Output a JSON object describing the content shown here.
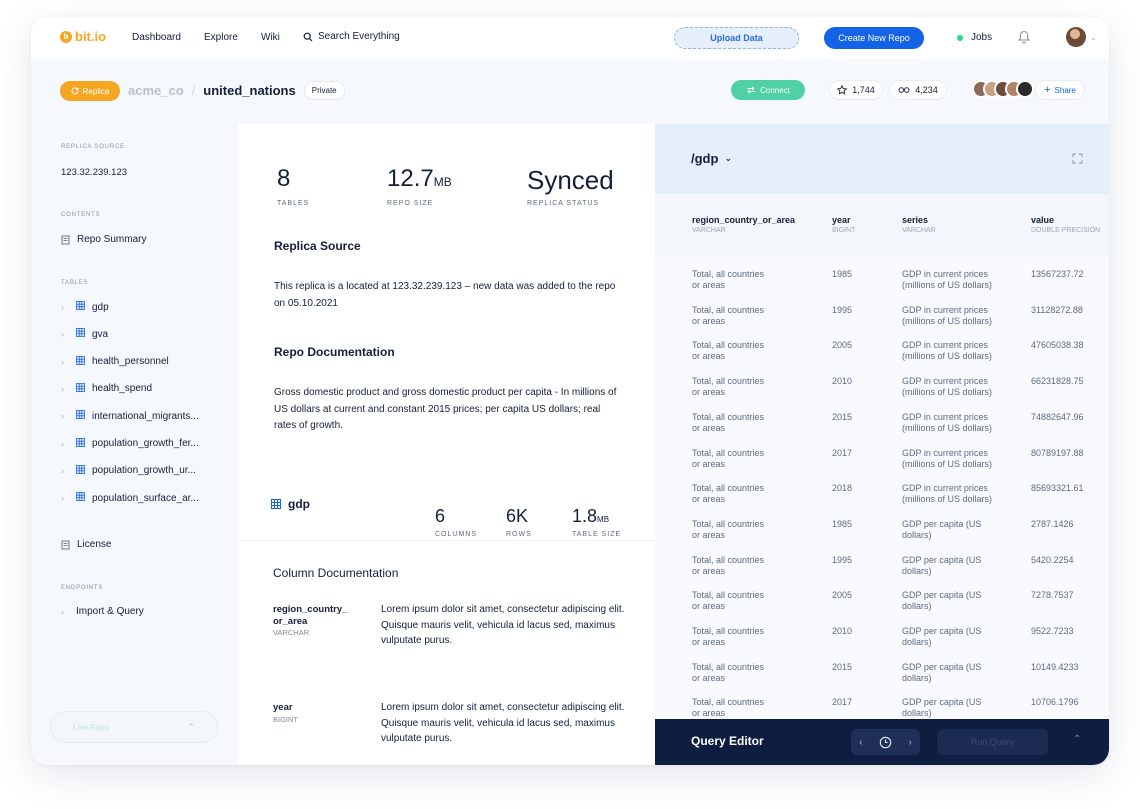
{
  "nav": {
    "logo_mark": "b",
    "logo": "bit.io",
    "links": [
      "Dashboard",
      "Explore",
      "Wiki"
    ],
    "search": "Search Everything",
    "upload": "Upload Data",
    "create": "Create New Repo",
    "jobs": "Jobs"
  },
  "header": {
    "replica": "Replica",
    "org": "acme_co",
    "repo": "united_nations",
    "visibility": "Private",
    "connect": "Connect",
    "stars": "1,744",
    "forks": "4,234",
    "share": "Share"
  },
  "sidebar": {
    "replica_source_label": "REPLICA SOURCE",
    "replica_source": "123.32.239.123",
    "contents_label": "CONTENTS",
    "repo_summary": "Repo Summary",
    "tables_label": "TABLES",
    "tables": [
      "gdp",
      "gva",
      "health_personnel",
      "health_spend",
      "international_migrants...",
      "population_growth_fer...",
      "population_growth_ur...",
      "population_surface_ar..."
    ],
    "license": "License",
    "endpoints_label": "ENDPOINTS",
    "import_query": "Import & Query",
    "live_repo": "Live Repo"
  },
  "summary": {
    "tables_value": "8",
    "tables_label": "TABLES",
    "size_value": "12.7",
    "size_unit": "MB",
    "size_label": "REPO SIZE",
    "status_value": "Synced",
    "status_label": "REPLICA STATUS",
    "replica_title": "Replica Source",
    "replica_text": "This replica is a located at 123.32.239.123 – new data was added to the repo on 05.10.2021",
    "doc_title": "Repo Documentation",
    "doc_text": "Gross domestic product and gross domestic product per capita - In millions of US dollars at current and constant 2015 prices; per capita US dollars; real rates of growth."
  },
  "table_info": {
    "name": "gdp",
    "columns_value": "6",
    "columns_label": "COLUMNS",
    "rows_value": "6K",
    "rows_label": "ROWS",
    "size_value": "1.8",
    "size_unit": "MB",
    "size_label": "TABLE SIZE"
  },
  "column_doc": {
    "title": "Column Documentation",
    "items": [
      {
        "name": "region_country_\nor_area",
        "type": "VARCHAR",
        "desc": "Lorem ipsum dolor sit amet, consectetur adipiscing elit. Quisque mauris velit, vehicula id lacus sed, maximus vulputate purus."
      },
      {
        "name": "year",
        "type": "BIGINT",
        "desc": "Lorem ipsum dolor sit amet, consectetur adipiscing elit. Quisque mauris velit, vehicula id lacus sed, maximus vulputate purus."
      }
    ]
  },
  "data_view": {
    "path": "/gdp",
    "columns": [
      {
        "name": "region_country_or_area",
        "type": "VARCHAR"
      },
      {
        "name": "year",
        "type": "BIGINT"
      },
      {
        "name": "series",
        "type": "VARCHAR"
      },
      {
        "name": "value",
        "type": "DOUBLE PRECISION"
      }
    ],
    "rows": [
      [
        "Total, all countries\nor areas",
        "1985",
        "GDP in current prices\n(millions of US dollars)",
        "13567237.72"
      ],
      [
        "Total, all countries\nor areas",
        "1995",
        "GDP in current prices\n(millions of US dollars)",
        "31128272.88"
      ],
      [
        "Total, all countries\nor areas",
        "2005",
        "GDP in current prices\n(millions of US dollars)",
        "47605038.38"
      ],
      [
        "Total, all countries\nor areas",
        "2010",
        "GDP in current prices\n(millions of US dollars)",
        "66231828.75"
      ],
      [
        "Total, all countries\nor areas",
        "2015",
        "GDP in current prices\n(millions of US dollars)",
        "74882647.96"
      ],
      [
        "Total, all countries\nor areas",
        "2017",
        "GDP in current prices\n(millions of US dollars)",
        "80789197.88"
      ],
      [
        "Total, all countries\nor areas",
        "2018",
        "GDP in current prices\n(millions of US dollars)",
        "85693321.61"
      ],
      [
        "Total, all countries\nor areas",
        "1985",
        "GDP per capita (US\ndollars)",
        "2787.1426"
      ],
      [
        "Total, all countries\nor areas",
        "1995",
        "GDP per capita (US\ndollars)",
        "5420.2254"
      ],
      [
        "Total, all countries\nor areas",
        "2005",
        "GDP per capita (US\ndollars)",
        "7278.7537"
      ],
      [
        "Total, all countries\nor areas",
        "2010",
        "GDP per capita (US\ndollars)",
        "9522.7233"
      ],
      [
        "Total, all countries\nor areas",
        "2015",
        "GDP per capita (US\ndollars)",
        "10149.4233"
      ],
      [
        "Total, all countries\nor areas",
        "2017",
        "GDP per capita (US\ndollars)",
        "10706.1796"
      ]
    ]
  },
  "query_editor": {
    "title": "Query Editor",
    "run": "Run Query"
  },
  "colors": {
    "accent": "#1463e6",
    "brand": "#f5a623",
    "connect": "#4fd1a5",
    "editor_bg": "#0f1d40"
  }
}
